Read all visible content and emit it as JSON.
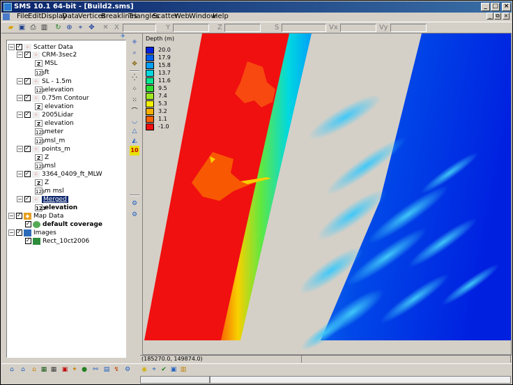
{
  "window": {
    "title": "SMS 10.1 64-bit - [Build2.sms]",
    "controls": [
      "_",
      "□",
      "×"
    ],
    "mdi_controls": [
      "_",
      "⧉",
      "×"
    ]
  },
  "menu": [
    "File",
    "Edit",
    "Display",
    "Data",
    "Vertices",
    "Breaklines",
    "Triangles",
    "Scatter",
    "Web",
    "Window",
    "Help"
  ],
  "toolbar": {
    "coord_labels": [
      "X",
      "Y",
      "Z",
      "S",
      "Vx",
      "Vy"
    ]
  },
  "tree": {
    "items": [
      {
        "label": "Scatter Data",
        "icon": "scatter-folder-icon",
        "level": 0
      },
      {
        "label": "CRM-3sec2",
        "icon": "scatter-set-icon",
        "level": 1
      },
      {
        "label": "MSL",
        "icon": "z-dataset-icon",
        "level": 2
      },
      {
        "label": "ft",
        "icon": "numeric-dataset-icon",
        "level": 2
      },
      {
        "label": "SL - 1.5m",
        "icon": "scatter-set-icon",
        "level": 1
      },
      {
        "label": "elevation",
        "icon": "numeric-dataset-icon",
        "level": 2
      },
      {
        "label": "0.75m Contour",
        "icon": "scatter-set-icon",
        "level": 1
      },
      {
        "label": "elevation",
        "icon": "z-dataset-icon",
        "level": 2
      },
      {
        "label": "2005Lidar",
        "icon": "scatter-set-icon",
        "level": 1
      },
      {
        "label": "elevation",
        "icon": "z-dataset-icon",
        "level": 2
      },
      {
        "label": "meter",
        "icon": "numeric-dataset-icon",
        "level": 2
      },
      {
        "label": "msl_m",
        "icon": "numeric-dataset-icon",
        "level": 2
      },
      {
        "label": "points_m",
        "icon": "scatter-set-icon",
        "level": 1
      },
      {
        "label": "Z",
        "icon": "z-dataset-icon",
        "level": 2
      },
      {
        "label": "msl",
        "icon": "numeric-dataset-icon",
        "level": 2
      },
      {
        "label": "3364_0409_ft_MLW",
        "icon": "scatter-set-icon",
        "level": 1
      },
      {
        "label": "Z",
        "icon": "z-dataset-icon",
        "level": 2
      },
      {
        "label": "m msl",
        "icon": "numeric-dataset-icon",
        "level": 2
      },
      {
        "label": "Merged",
        "icon": "scatter-set-icon",
        "level": 1,
        "selected": true
      },
      {
        "label": "elevation",
        "icon": "numeric-dataset-icon",
        "level": 2,
        "bold": true
      },
      {
        "label": "Map Data",
        "icon": "map-folder-icon",
        "level": 0
      },
      {
        "label": "default coverage",
        "icon": "coverage-icon",
        "level": 1,
        "bold": true
      },
      {
        "label": "Images",
        "icon": "image-folder-icon",
        "level": 0
      },
      {
        "label": "Rect_10ct2006",
        "icon": "image-file-icon",
        "level": 1
      }
    ]
  },
  "legend": {
    "title": "Depth (m)",
    "entries": [
      {
        "value": "20.0",
        "color": "#0020e0"
      },
      {
        "value": "17.9",
        "color": "#0060f0"
      },
      {
        "value": "15.8",
        "color": "#00a0f8"
      },
      {
        "value": "13.7",
        "color": "#00d8e0"
      },
      {
        "value": "11.6",
        "color": "#00e890"
      },
      {
        "value": "9.5",
        "color": "#30e030"
      },
      {
        "value": "7.4",
        "color": "#a0e820"
      },
      {
        "value": "5.3",
        "color": "#f0f000"
      },
      {
        "value": "3.2",
        "color": "#f8b000"
      },
      {
        "value": "1.1",
        "color": "#f86000"
      },
      {
        "value": "-1.0",
        "color": "#f01010"
      }
    ]
  },
  "status": {
    "coords": "(185270.0, 149874.0)"
  }
}
